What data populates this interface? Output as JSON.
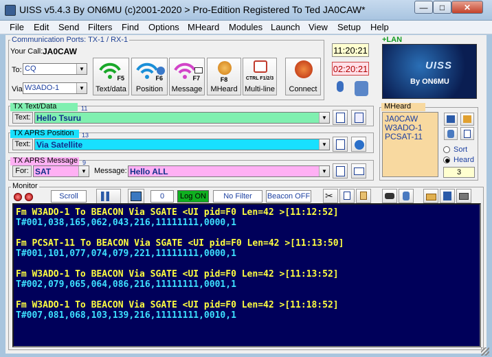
{
  "window": {
    "title": "UISS v5.4.3 By ON6MU (c)2001-2020 > Pro-Edition Registered To Ted JA0CAW*",
    "min": "—",
    "max": "□",
    "close": "✕"
  },
  "menu": [
    "File",
    "Edit",
    "Send",
    "Filters",
    "Find",
    "Options",
    "MHeard",
    "Modules",
    "Launch",
    "View",
    "Setup",
    "Help"
  ],
  "comm": {
    "label": "Communication Ports: TX-1 / RX-1",
    "your_call_label": "Your Call:",
    "your_call": "JA0CAW",
    "to_label": "To:",
    "to_value": "CQ",
    "via_label": "Via:",
    "via_value": "W3ADO-1"
  },
  "tools": [
    {
      "key": "F5",
      "label": "Text/data"
    },
    {
      "key": "F6",
      "label": "Position"
    },
    {
      "key": "F7",
      "label": "Message"
    },
    {
      "key": "F8",
      "label": "MHeard"
    },
    {
      "key": "CTRL F1/2/3",
      "label": "Multi-line"
    },
    {
      "key": "",
      "label": "Connect"
    }
  ],
  "clock": {
    "utc": "11:20:21",
    "local": "02:20:21"
  },
  "logo": {
    "lan": "+LAN",
    "name": "UISS",
    "by": "By ON6MU"
  },
  "tx_text": {
    "label": "TX Text/Data",
    "num": "11",
    "field_label": "Text:",
    "value": "Hello Tsuru"
  },
  "tx_pos": {
    "label": "TX APRS Position",
    "num": "13",
    "field_label": "Text:",
    "value": "Via Satellite"
  },
  "tx_msg": {
    "label": "TX APRS Message",
    "num": "9",
    "for_label": "For:",
    "for_value": "SAT",
    "msg_label": "Message:",
    "msg_value": "Hello ALL"
  },
  "mheard": {
    "label": "MHeard",
    "items": [
      "JA0CAW",
      "W3ADO-1",
      "PCSAT-11"
    ],
    "sort_label": "Sort",
    "heard_label": "Heard",
    "count": "3"
  },
  "monitor_bar": {
    "label": "Monitor",
    "scroll": "Scroll",
    "counter": "0",
    "log": "Log ON",
    "filter": "No Filter",
    "beacon": "Beacon OFF"
  },
  "colors": {
    "tx_text_bg": "#80f0b0",
    "tx_pos_bg": "#18e0ff",
    "tx_msg_bg": "#ffb0f4",
    "mheard_bg": "#f8d9a0",
    "monitor_bg": "#00005a",
    "monitor_header": "#ffff40",
    "monitor_data": "#3de0ff"
  },
  "monitor_lines": [
    {
      "type": "hdr",
      "text": "Fm W3ADO-1 To BEACON Via SGATE <UI pid=F0 Len=42 >[11:12:52]"
    },
    {
      "type": "dat",
      "text": "T#001,038,165,062,043,216,11111111,0000,1"
    },
    {
      "type": "hdr",
      "text": "Fm PCSAT-11 To BEACON Via SGATE <UI pid=F0 Len=42 >[11:13:50]"
    },
    {
      "type": "dat",
      "text": "T#001,101,077,074,079,221,11111111,0000,1"
    },
    {
      "type": "hdr",
      "text": "Fm W3ADO-1 To BEACON Via SGATE <UI pid=F0 Len=42 >[11:13:52]"
    },
    {
      "type": "dat",
      "text": "T#002,079,065,064,086,216,11111111,0001,1"
    },
    {
      "type": "hdr",
      "text": "Fm W3ADO-1 To BEACON Via SGATE <UI pid=F0 Len=42 >[11:18:52]"
    },
    {
      "type": "dat",
      "text": "T#007,081,068,103,139,216,11111111,0010,1"
    }
  ]
}
